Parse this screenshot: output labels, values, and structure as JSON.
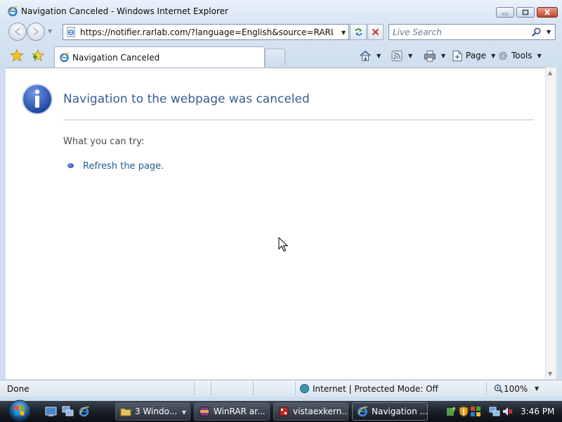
{
  "window": {
    "title": "Navigation Canceled - Windows Internet Explorer",
    "caption_buttons": [
      "minimize-icon",
      "maximize-icon",
      "close-icon"
    ]
  },
  "address_bar": {
    "url": "https://notifier.rarlab.com/?language=English&source=RARLAB&lar",
    "search_placeholder": "Live Search"
  },
  "command_bar": {
    "tab_label": "Navigation Canceled",
    "page_label": "Page",
    "tools_label": "Tools"
  },
  "content": {
    "heading": "Navigation to the webpage was canceled",
    "try_label": "What you can try:",
    "refresh_link": "Refresh the page."
  },
  "status_bar": {
    "status": "Done",
    "zone": "Internet | Protected Mode: Off",
    "zoom": "100%"
  },
  "taskbar": {
    "buttons": [
      {
        "label": "3 Windo...",
        "icon": "folder-icon"
      },
      {
        "label": "WinRAR ar...",
        "icon": "winrar-icon"
      },
      {
        "label": "vistaexkern...",
        "icon": "app-icon"
      },
      {
        "label": "Navigation ...",
        "icon": "ie-icon"
      }
    ],
    "clock": "3:46 PM"
  },
  "colors": {
    "heading": "#365f8a",
    "link": "#1f5f8f",
    "taskbar": "#1b1f26"
  }
}
